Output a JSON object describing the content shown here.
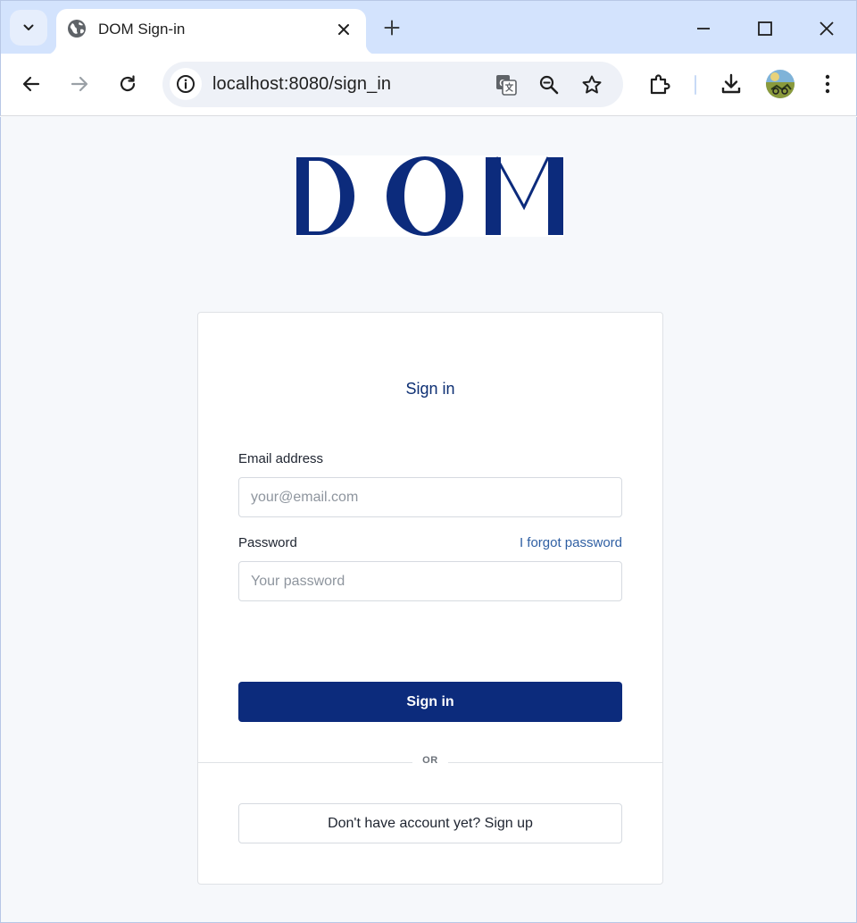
{
  "browser": {
    "tab": {
      "title": "DOM Sign-in",
      "favicon": "globe-icon"
    },
    "url": "localhost:8080/sign_in",
    "colors": {
      "tabstrip": "#d3e3fd",
      "omnibox": "#eef1f7"
    }
  },
  "page": {
    "logo_text": "DOM",
    "logo_color": "#0c2b7c",
    "signin_form": {
      "title": "Sign in",
      "email_label": "Email address",
      "email_placeholder": "your@email.com",
      "email_value": "",
      "password_label": "Password",
      "password_placeholder": "Your password",
      "password_value": "",
      "forgot_link": "I forgot password",
      "submit_label": "Sign in",
      "divider_text": "OR",
      "signup_label": "Don't have account yet? Sign up",
      "accent_color": "#0c2b7c"
    }
  }
}
